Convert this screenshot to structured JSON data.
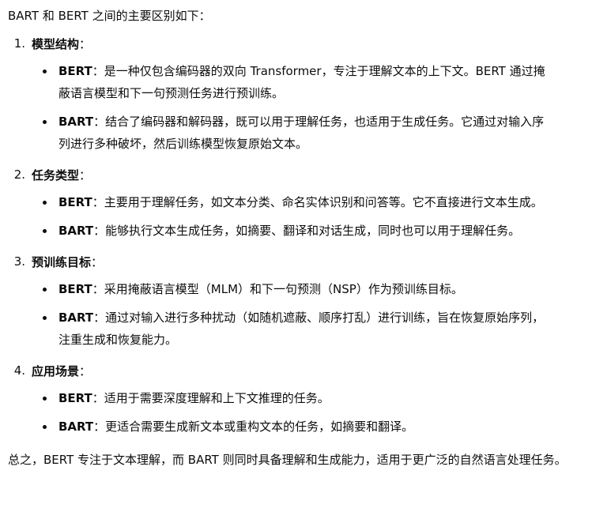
{
  "intro": "BART 和 BERT 之间的主要区别如下：",
  "colon": "：",
  "sections": [
    {
      "num": "1.",
      "title": "模型结构",
      "points": [
        {
          "term": "BERT",
          "text": "：是一种仅包含编码器的双向 Transformer，专注于理解文本的上下文。BERT 通过掩蔽语言模型和下一句预测任务进行预训练。"
        },
        {
          "term": "BART",
          "text": "：结合了编码器和解码器，既可以用于理解任务，也适用于生成任务。它通过对输入序列进行多种破坏，然后训练模型恢复原始文本。"
        }
      ]
    },
    {
      "num": "2.",
      "title": "任务类型",
      "points": [
        {
          "term": "BERT",
          "text": "：主要用于理解任务，如文本分类、命名实体识别和问答等。它不直接进行文本生成。"
        },
        {
          "term": "BART",
          "text": "：能够执行文本生成任务，如摘要、翻译和对话生成，同时也可以用于理解任务。"
        }
      ]
    },
    {
      "num": "3.",
      "title": "预训练目标",
      "points": [
        {
          "term": "BERT",
          "text": "：采用掩蔽语言模型（MLM）和下一句预测（NSP）作为预训练目标。"
        },
        {
          "term": "BART",
          "text": "：通过对输入进行多种扰动（如随机遮蔽、顺序打乱）进行训练，旨在恢复原始序列，注重生成和恢复能力。"
        }
      ]
    },
    {
      "num": "4.",
      "title": "应用场景",
      "points": [
        {
          "term": "BERT",
          "text": "：适用于需要深度理解和上下文推理的任务。"
        },
        {
          "term": "BART",
          "text": "：更适合需要生成新文本或重构文本的任务，如摘要和翻译。"
        }
      ]
    }
  ],
  "summary": "总之，BERT 专注于文本理解，而 BART 则同时具备理解和生成能力，适用于更广泛的自然语言处理任务。"
}
